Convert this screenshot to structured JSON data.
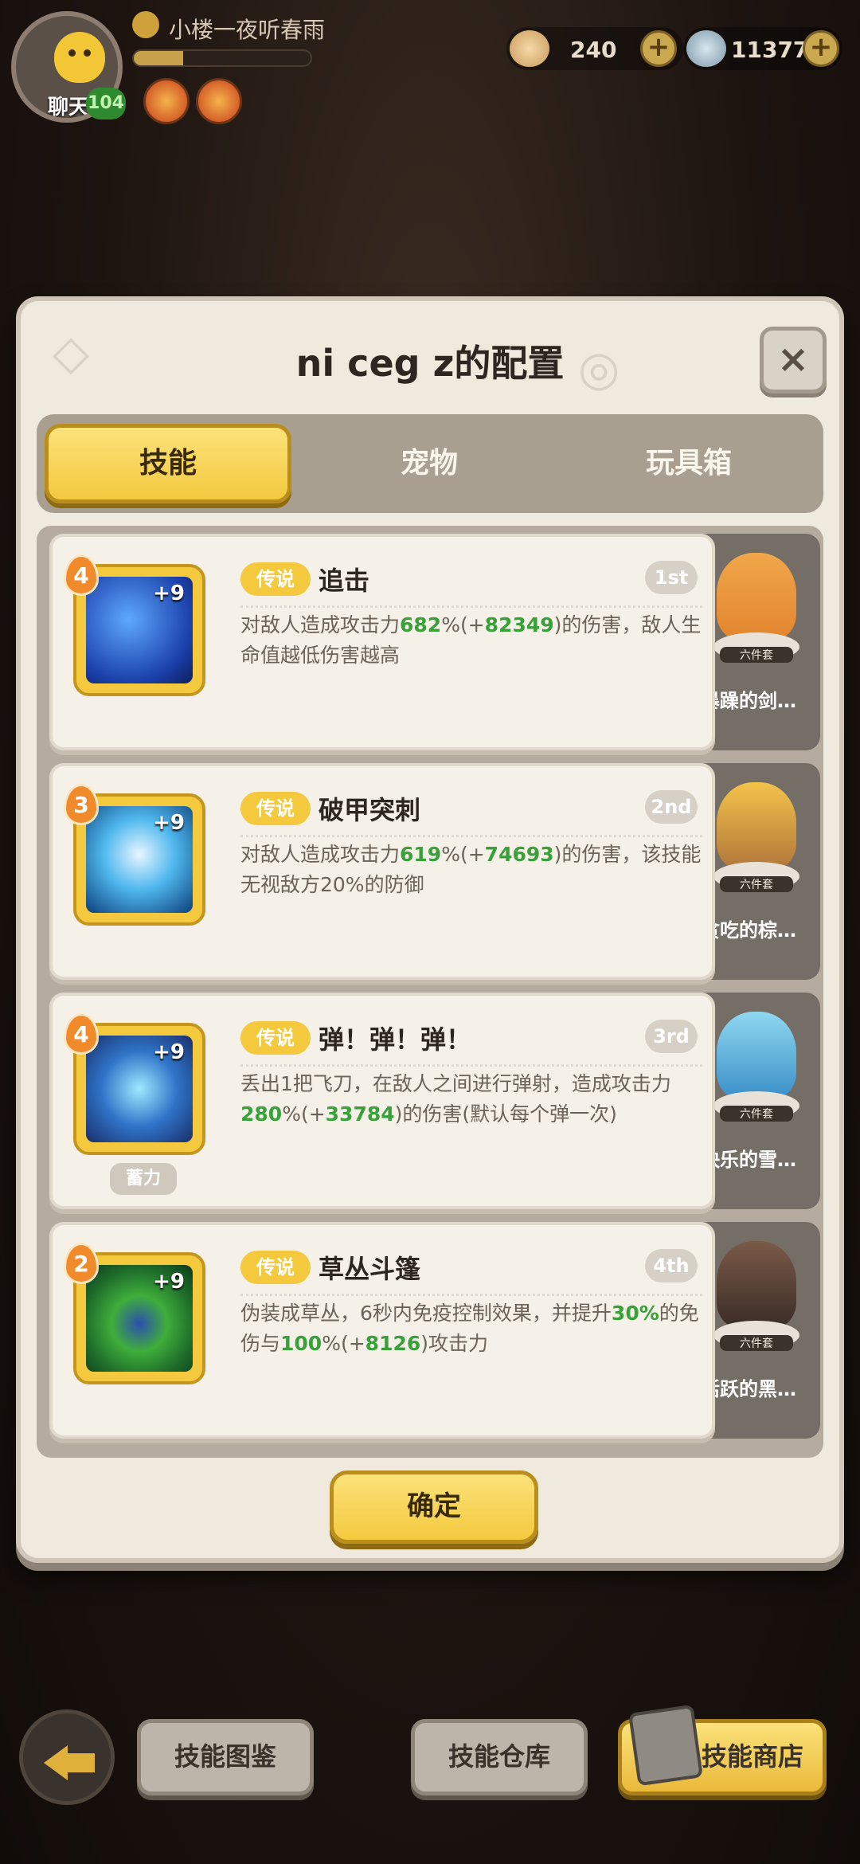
{
  "hud": {
    "chat_label": "聊天",
    "level": "104",
    "player_name": "小楼一夜听春雨",
    "xp_fraction": 0.28,
    "currency_1": "240",
    "currency_2": "113774",
    "plus": "+"
  },
  "dialog": {
    "title": "ni ceg z的配置",
    "close": "×",
    "tabs": [
      "技能",
      "宠物",
      "玩具箱"
    ],
    "active_tab": 0,
    "confirm": "确定"
  },
  "skills": [
    {
      "level": "4",
      "plus": "+9",
      "rarity": "传说",
      "name": "追击",
      "rank": "1st",
      "desc_parts": [
        "对敌人造成攻击力",
        "682",
        "%(+",
        "82349",
        ")的伤害，敌人生命值越低伤害越高"
      ],
      "pet_set": "六件套",
      "pet_name": "暴躁的剑…"
    },
    {
      "level": "3",
      "plus": "+9",
      "rarity": "传说",
      "name": "破甲突刺",
      "rank": "2nd",
      "desc_parts": [
        "对敌人造成攻击力",
        "619",
        "%(+",
        "74693",
        ")的伤害，该技能无视敌方20%的防御"
      ],
      "pet_set": "六件套",
      "pet_name": "贪吃的棕…"
    },
    {
      "level": "4",
      "plus": "+9",
      "rarity": "传说",
      "name": "弹！弹！弹！",
      "rank": "3rd",
      "desc_parts": [
        "丢出1把飞刀，在敌人之间进行弹射，造成攻击力",
        "280",
        "%(+",
        "33784",
        ")的伤害(默认每个弹一次)"
      ],
      "charge": "蓄力",
      "pet_set": "六件套",
      "pet_name": "快乐的雪…"
    },
    {
      "level": "2",
      "plus": "+9",
      "rarity": "传说",
      "name": "草丛斗篷",
      "rank": "4th",
      "desc_parts": [
        "伪装成草丛，6秒内免疫控制效果，并提升",
        "30%",
        "的免伤与",
        "100",
        "%(+",
        "8126",
        ")攻击力"
      ],
      "pet_set": "六件套",
      "pet_name": "活跃的黑…"
    }
  ],
  "bottom": {
    "btn_codex": "技能图鉴",
    "btn_storage": "技能仓库",
    "btn_shop": "技能商店"
  },
  "icons": [
    "chat-avatar-icon",
    "coin-icon",
    "gem-icon",
    "plus-icon",
    "close-icon",
    "back-arrow-icon",
    "shop-icon"
  ],
  "colors": {
    "accent": "#f4c93e",
    "green_value": "#3aa03a",
    "panel": "#efe9de"
  }
}
